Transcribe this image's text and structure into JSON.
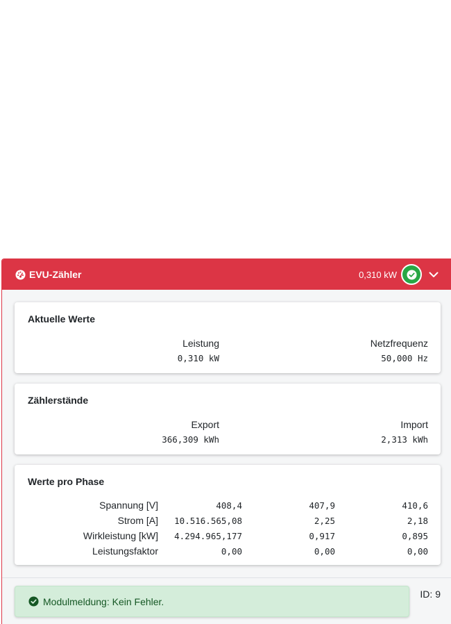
{
  "header": {
    "title": "EVU-Zähler",
    "power": "0,310 kW",
    "icon": "tachometer-icon",
    "status_icon": "check-circle-icon",
    "toggle_icon": "chevron-down-icon",
    "color": "#dc3545",
    "status_color": "#28a745"
  },
  "current": {
    "title": "Aktuelle Werte",
    "power_label": "Leistung",
    "power_value": "0,310 kW",
    "frequency_label": "Netzfrequenz",
    "frequency_value": "50,000 Hz"
  },
  "counters": {
    "title": "Zählerstände",
    "export_label": "Export",
    "export_value": "366,309 kWh",
    "import_label": "Import",
    "import_value": "2,313 kWh"
  },
  "phases": {
    "title": "Werte pro Phase",
    "rows": [
      {
        "label": "Spannung [V]",
        "values": [
          "408,4",
          "407,9",
          "410,6"
        ]
      },
      {
        "label": "Strom [A]",
        "values": [
          "10.516.565,08",
          "2,25",
          "2,18"
        ]
      },
      {
        "label": "Wirkleistung [kW]",
        "values": [
          "4.294.965,177",
          "0,917",
          "0,895"
        ]
      },
      {
        "label": "Leistungsfaktor",
        "values": [
          "0,00",
          "0,00",
          "0,00"
        ]
      }
    ]
  },
  "footer": {
    "message": "Modulmeldung: Kein Fehler.",
    "message_icon": "check-circle-icon",
    "id_label": "ID: 9",
    "message_color": "#155724"
  }
}
